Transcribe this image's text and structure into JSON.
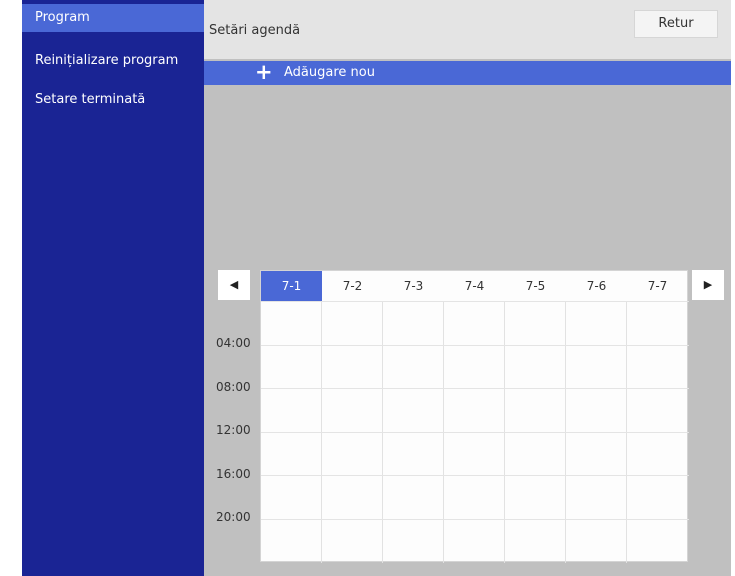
{
  "sidebar": {
    "items": [
      {
        "label": "Program"
      },
      {
        "label": "Reinițializare program"
      },
      {
        "label": "Setare terminată"
      }
    ]
  },
  "header": {
    "title": "Setări agendă",
    "back_label": "Retur"
  },
  "add_bar": {
    "icon": "plus-icon",
    "label": "Adăugare nou"
  },
  "calendar": {
    "prev_icon": "triangle-left-icon",
    "next_icon": "triangle-right-icon",
    "selected_day": "7-1",
    "days": [
      "7-1",
      "7-2",
      "7-3",
      "7-4",
      "7-5",
      "7-6",
      "7-7"
    ],
    "times": [
      "04:00",
      "08:00",
      "12:00",
      "16:00",
      "20:00"
    ]
  },
  "colors": {
    "sidebar_bg": "#1a2494",
    "accent": "#4a68d6",
    "panel_bg": "#c0c0c0",
    "header_bg": "#e4e4e4"
  }
}
